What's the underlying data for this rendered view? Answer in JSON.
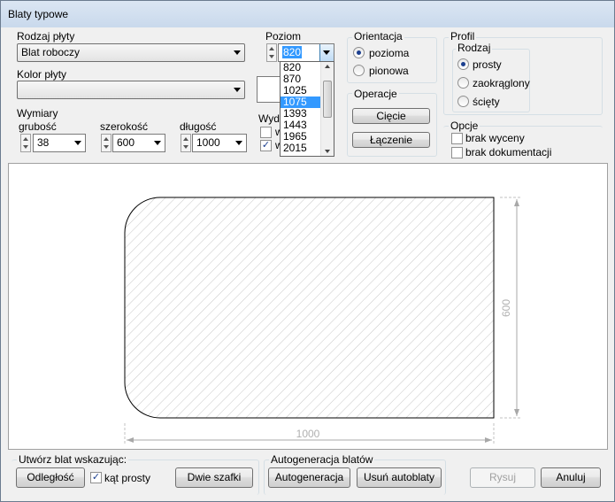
{
  "window": {
    "title": "Blaty typowe"
  },
  "rodzaj": {
    "label": "Rodzaj płyty",
    "value": "Blat roboczy"
  },
  "kolor": {
    "label": "Kolor płyty",
    "value": ""
  },
  "wymiary": {
    "label": "Wymiary",
    "grubosc_label": "grubość",
    "grubosc_value": "38",
    "szerokosc_label": "szerokość",
    "szerokosc_value": "600",
    "dlugosc_label": "długość",
    "dlugosc_value": "1000"
  },
  "poziom": {
    "label": "Poziom",
    "value": "820",
    "options": [
      "820",
      "870",
      "1025",
      "1075",
      "1393",
      "1443",
      "1965",
      "2015"
    ],
    "selected_index": 3
  },
  "wydl": {
    "label": "Wydł",
    "check1": "w",
    "check2": "w"
  },
  "orientacja": {
    "label": "Orientacja",
    "opt1": "pozioma",
    "opt2": "pionowa"
  },
  "operacje": {
    "label": "Operacje",
    "ciecie": "Cięcie",
    "laczenie": "Łączenie"
  },
  "profil": {
    "label": "Profil",
    "rodzaj_label": "Rodzaj",
    "opt1": "prosty",
    "opt2": "zaokrąglony",
    "opt3": "ścięty"
  },
  "opcje": {
    "label": "Opcje",
    "opt1": "brak wyceny",
    "opt2": "brak dokumentacji"
  },
  "drawing": {
    "height_dim": "600",
    "width_dim": "1000"
  },
  "utworz": {
    "label": "Utwórz blat wskazując:",
    "odleglosc": "Odległość",
    "kat_prosty": "kąt prosty",
    "dwie_szafki": "Dwie szafki"
  },
  "autogen": {
    "label": "Autogeneracja blatów",
    "autogeneracja": "Autogeneracja",
    "usun": "Usuń autoblaty"
  },
  "footer": {
    "rysuj": "Rysuj",
    "anuluj": "Anuluj"
  }
}
